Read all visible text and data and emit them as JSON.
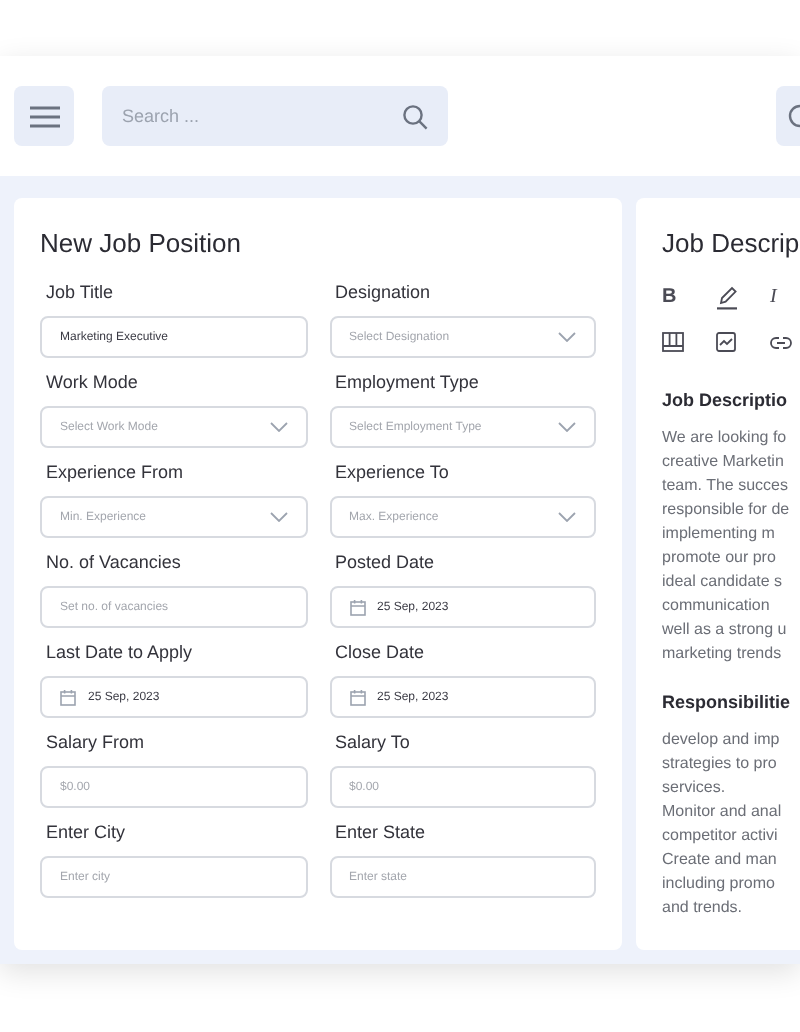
{
  "top_bar": {
    "search": {
      "placeholder": "Search ..."
    }
  },
  "form": {
    "title": "New Job Position",
    "fields": [
      {
        "label": "Job Title",
        "kind": "text",
        "value": "Marketing Executive"
      },
      {
        "label": "Designation",
        "kind": "select",
        "placeholder": "Select Designation"
      },
      {
        "label": "Work Mode",
        "kind": "select",
        "placeholder": "Select Work Mode"
      },
      {
        "label": "Employment Type",
        "kind": "select",
        "placeholder": "Select Employment Type"
      },
      {
        "label": "Experience From",
        "kind": "select",
        "placeholder": "Min. Experience"
      },
      {
        "label": "Experience To",
        "kind": "select",
        "placeholder": "Max. Experience"
      },
      {
        "label": "No. of Vacancies",
        "kind": "text",
        "placeholder": "Set no. of vacancies"
      },
      {
        "label": "Posted Date",
        "kind": "date",
        "value": "25 Sep, 2023"
      },
      {
        "label": "Last Date to Apply",
        "kind": "date",
        "value": "25 Sep, 2023"
      },
      {
        "label": "Close Date",
        "kind": "date",
        "value": "25 Sep, 2023"
      },
      {
        "label": "Salary From",
        "kind": "text",
        "placeholder": "$0.00"
      },
      {
        "label": "Salary To",
        "kind": "text",
        "placeholder": "$0.00"
      },
      {
        "label": "Enter City",
        "kind": "text",
        "placeholder": "Enter city"
      },
      {
        "label": "Enter State",
        "kind": "text",
        "placeholder": "Enter state"
      }
    ]
  },
  "description": {
    "title": "Job Descrip",
    "toolbar": [
      {
        "kind": "bold",
        "label": "B"
      },
      {
        "kind": "highlight"
      },
      {
        "kind": "italic",
        "label": "I"
      },
      {
        "kind": "layout"
      },
      {
        "kind": "image"
      },
      {
        "kind": "link"
      }
    ],
    "sections": [
      {
        "heading": "Job Descriptio",
        "lines": [
          "We are looking fo",
          "creative Marketin",
          "team. The succes",
          "responsible for de",
          "implementing m",
          "promote our pro",
          "ideal candidate s",
          "communication",
          "well as a strong u",
          "marketing trends"
        ]
      },
      {
        "heading": "Responsibilitie",
        "lines": [
          "develop and imp",
          "strategies to pro",
          "services.",
          "Monitor and anal",
          "competitor activi",
          "Create and man",
          "including promo",
          "and trends."
        ]
      }
    ]
  }
}
